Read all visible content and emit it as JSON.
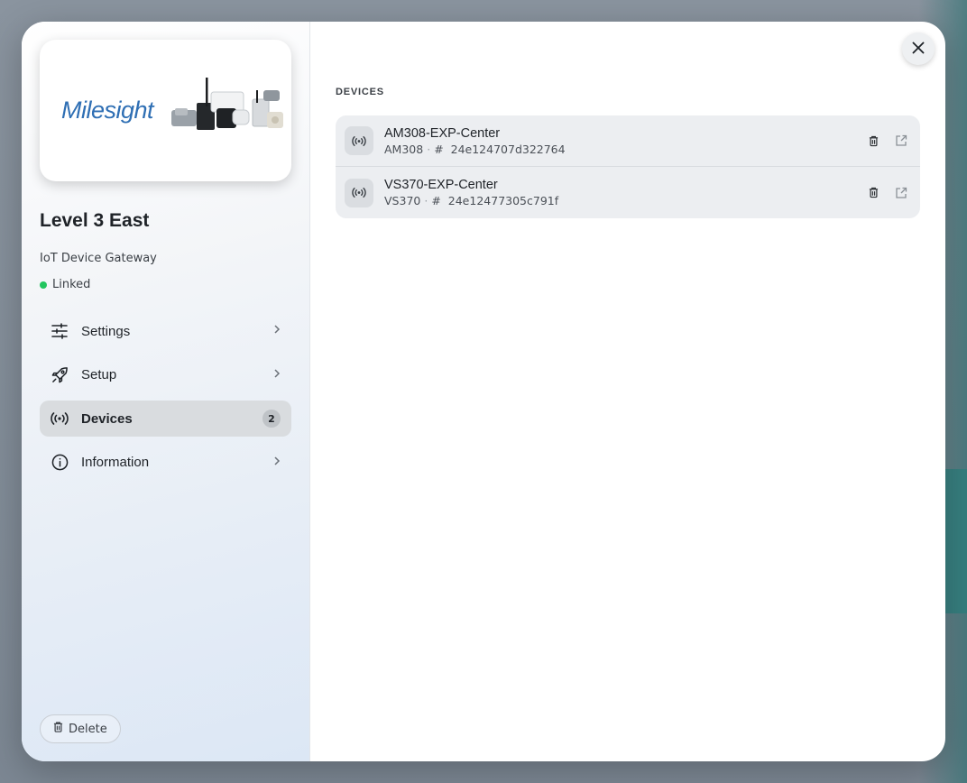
{
  "gateway": {
    "brand": "Milesight",
    "title": "Level 3 East",
    "type": "IoT Device Gateway",
    "status": "Linked"
  },
  "nav": {
    "items": [
      {
        "label": "Settings",
        "icon": "sliders-icon"
      },
      {
        "label": "Setup",
        "icon": "rocket-icon"
      },
      {
        "label": "Devices",
        "icon": "broadcast-icon",
        "badge": "2",
        "active": true
      },
      {
        "label": "Information",
        "icon": "info-icon"
      }
    ]
  },
  "actions": {
    "delete_label": "Delete"
  },
  "devices": {
    "section_label": "DEVICES",
    "items": [
      {
        "name": "AM308-EXP-Center",
        "model": "AM308",
        "id_prefix": "#",
        "eui": "24e124707d322764"
      },
      {
        "name": "VS370-EXP-Center",
        "model": "VS370",
        "id_prefix": "#",
        "eui": "24e12477305c791f"
      }
    ]
  },
  "colors": {
    "status_linked": "#22c55e",
    "brand": "#2f6fb4"
  }
}
